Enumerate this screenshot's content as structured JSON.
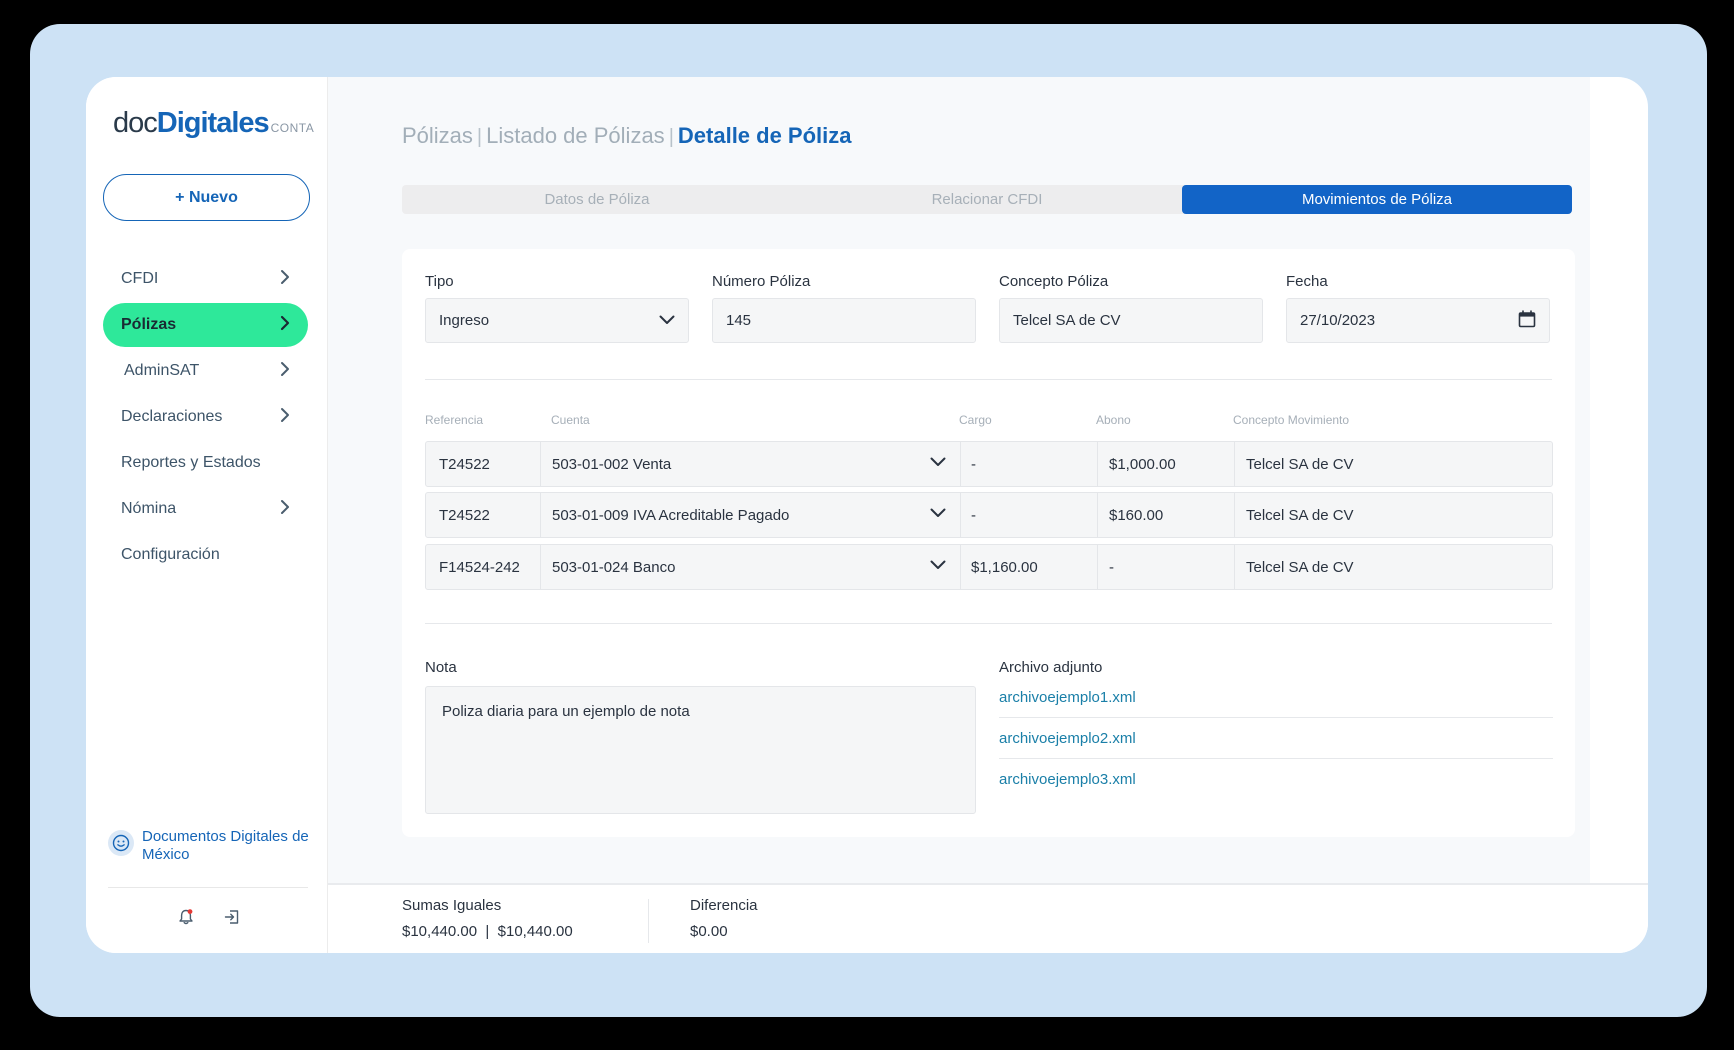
{
  "logo": {
    "part1": "doc",
    "part2": "Digitales",
    "part3": "CONTA"
  },
  "new_button": {
    "label": "+ Nuevo"
  },
  "sidebar": {
    "items": [
      {
        "label": "CFDI",
        "has_chevron": true
      },
      {
        "label": "Pólizas",
        "has_chevron": true,
        "active": true
      },
      {
        "label": "AdminSAT",
        "has_chevron": true
      },
      {
        "label": "Declaraciones",
        "has_chevron": true
      },
      {
        "label": "Reportes y Estados",
        "has_chevron": false
      },
      {
        "label": "Nómina",
        "has_chevron": true
      },
      {
        "label": "Configuración",
        "has_chevron": false
      }
    ],
    "company": "Documentos Digitales de México"
  },
  "breadcrumb": {
    "level1": "Pólizas",
    "level2": "Listado de Pólizas",
    "current": "Detalle de  Póliza"
  },
  "tabs": [
    "Datos de Póliza",
    "Relacionar CFDI",
    "Movimientos de Póliza"
  ],
  "form": {
    "tipo": {
      "label": "Tipo",
      "value": "Ingreso"
    },
    "numero": {
      "label": "Número Póliza",
      "value": "145"
    },
    "concepto": {
      "label": "Concepto Póliza",
      "value": "Telcel SA de CV"
    },
    "fecha": {
      "label": "Fecha",
      "value": "27/10/2023"
    }
  },
  "table": {
    "headers": [
      "Referencia",
      "Cuenta",
      "Cargo",
      "Abono",
      "Concepto Movimiento"
    ],
    "rows": [
      {
        "referencia": "T24522",
        "cuenta": "503-01-002 Venta",
        "cargo": "-",
        "abono": "$1,000.00",
        "concepto": "Telcel SA de CV"
      },
      {
        "referencia": "T24522",
        "cuenta": "503-01-009 IVA Acreditable Pagado",
        "cargo": "-",
        "abono": "$160.00",
        "concepto": "Telcel SA de CV"
      },
      {
        "referencia": "F14524-242",
        "cuenta": "503-01-024 Banco",
        "cargo": "$1,160.00",
        "abono": "-",
        "concepto": "Telcel SA de CV"
      }
    ]
  },
  "nota": {
    "label": "Nota",
    "value": "Poliza diaria para un ejemplo de nota"
  },
  "adjunto": {
    "label": "Archivo adjunto",
    "files": [
      "archivoejemplo1.xml",
      "archivoejemplo2.xml",
      "archivoejemplo3.xml"
    ]
  },
  "footer": {
    "sumas_label": "Sumas Iguales",
    "sumas_value": "$10,440.00  |  $10,440.00",
    "diferencia_label": "Diferencia",
    "diferencia_value": "$0.00"
  },
  "colors": {
    "accent": "#1565b7",
    "active_nav": "#2ee89a",
    "tab_active": "#1264c7",
    "link": "#1a7fa8"
  }
}
